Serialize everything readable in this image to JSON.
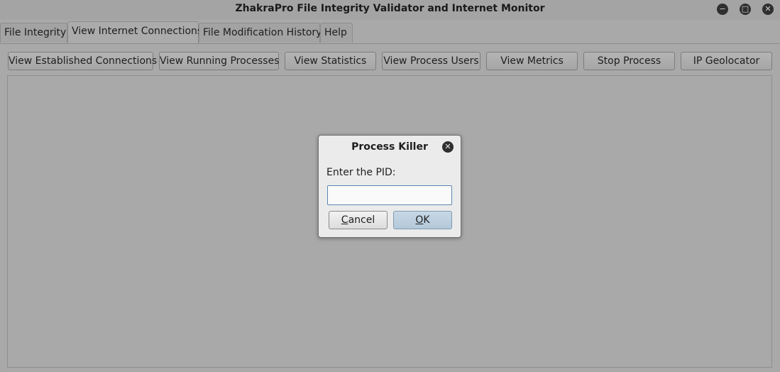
{
  "window": {
    "title": "ZhakraPro File Integrity Validator and Internet Monitor",
    "controls": {
      "minimize": "−",
      "maximize": "□",
      "close": "✕"
    }
  },
  "tabs": [
    {
      "label": "File Integrity",
      "active": false
    },
    {
      "label": "View Internet Connections",
      "active": true
    },
    {
      "label": "File Modification History",
      "active": false
    },
    {
      "label": "Help",
      "active": false
    }
  ],
  "toolbar": {
    "buttons": [
      "View Established Connections",
      "View Running Processes",
      "View Statistics",
      "View Process Users",
      "View Metrics",
      "Stop Process",
      "IP Geolocator"
    ]
  },
  "dialog": {
    "title": "Process Killer",
    "close_icon": "✕",
    "label": "Enter the PID:",
    "input_value": "",
    "cancel_first": "C",
    "cancel_rest": "ancel",
    "ok_first": "O",
    "ok_rest": "K"
  },
  "colors": {
    "background": "#a9a9a9",
    "dialog_background": "#ebebeb",
    "ok_button": "#bcd0e0",
    "input_border": "#5a87b4"
  }
}
